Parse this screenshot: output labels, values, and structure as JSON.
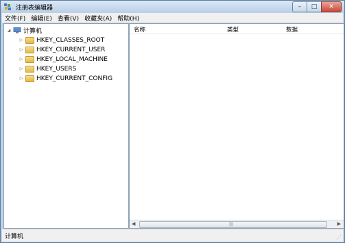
{
  "window": {
    "title": "注册表编辑器",
    "buttons": {
      "minimize": "–",
      "maximize": "□",
      "close": "✕"
    }
  },
  "menu": [
    "文件(F)",
    "编辑(E)",
    "查看(V)",
    "收藏夹(A)",
    "帮助(H)"
  ],
  "tree": {
    "root": {
      "label": "计算机",
      "expander": "◢"
    },
    "children": [
      {
        "label": "HKEY_CLASSES_ROOT",
        "expander": "▷"
      },
      {
        "label": "HKEY_CURRENT_USER",
        "expander": "▷"
      },
      {
        "label": "HKEY_LOCAL_MACHINE",
        "expander": "▷"
      },
      {
        "label": "HKEY_USERS",
        "expander": "▷"
      },
      {
        "label": "HKEY_CURRENT_CONFIG",
        "expander": "▷"
      }
    ]
  },
  "list": {
    "columns": [
      "名称",
      "类型",
      "数据"
    ]
  },
  "scroll": {
    "left": "◀",
    "right": "▶",
    "grip": "|||"
  },
  "status": {
    "path": "计算机"
  },
  "colors": {
    "titlebar": "#c5d8ec",
    "folder": "#e9c35b",
    "close": "#c8473b"
  }
}
